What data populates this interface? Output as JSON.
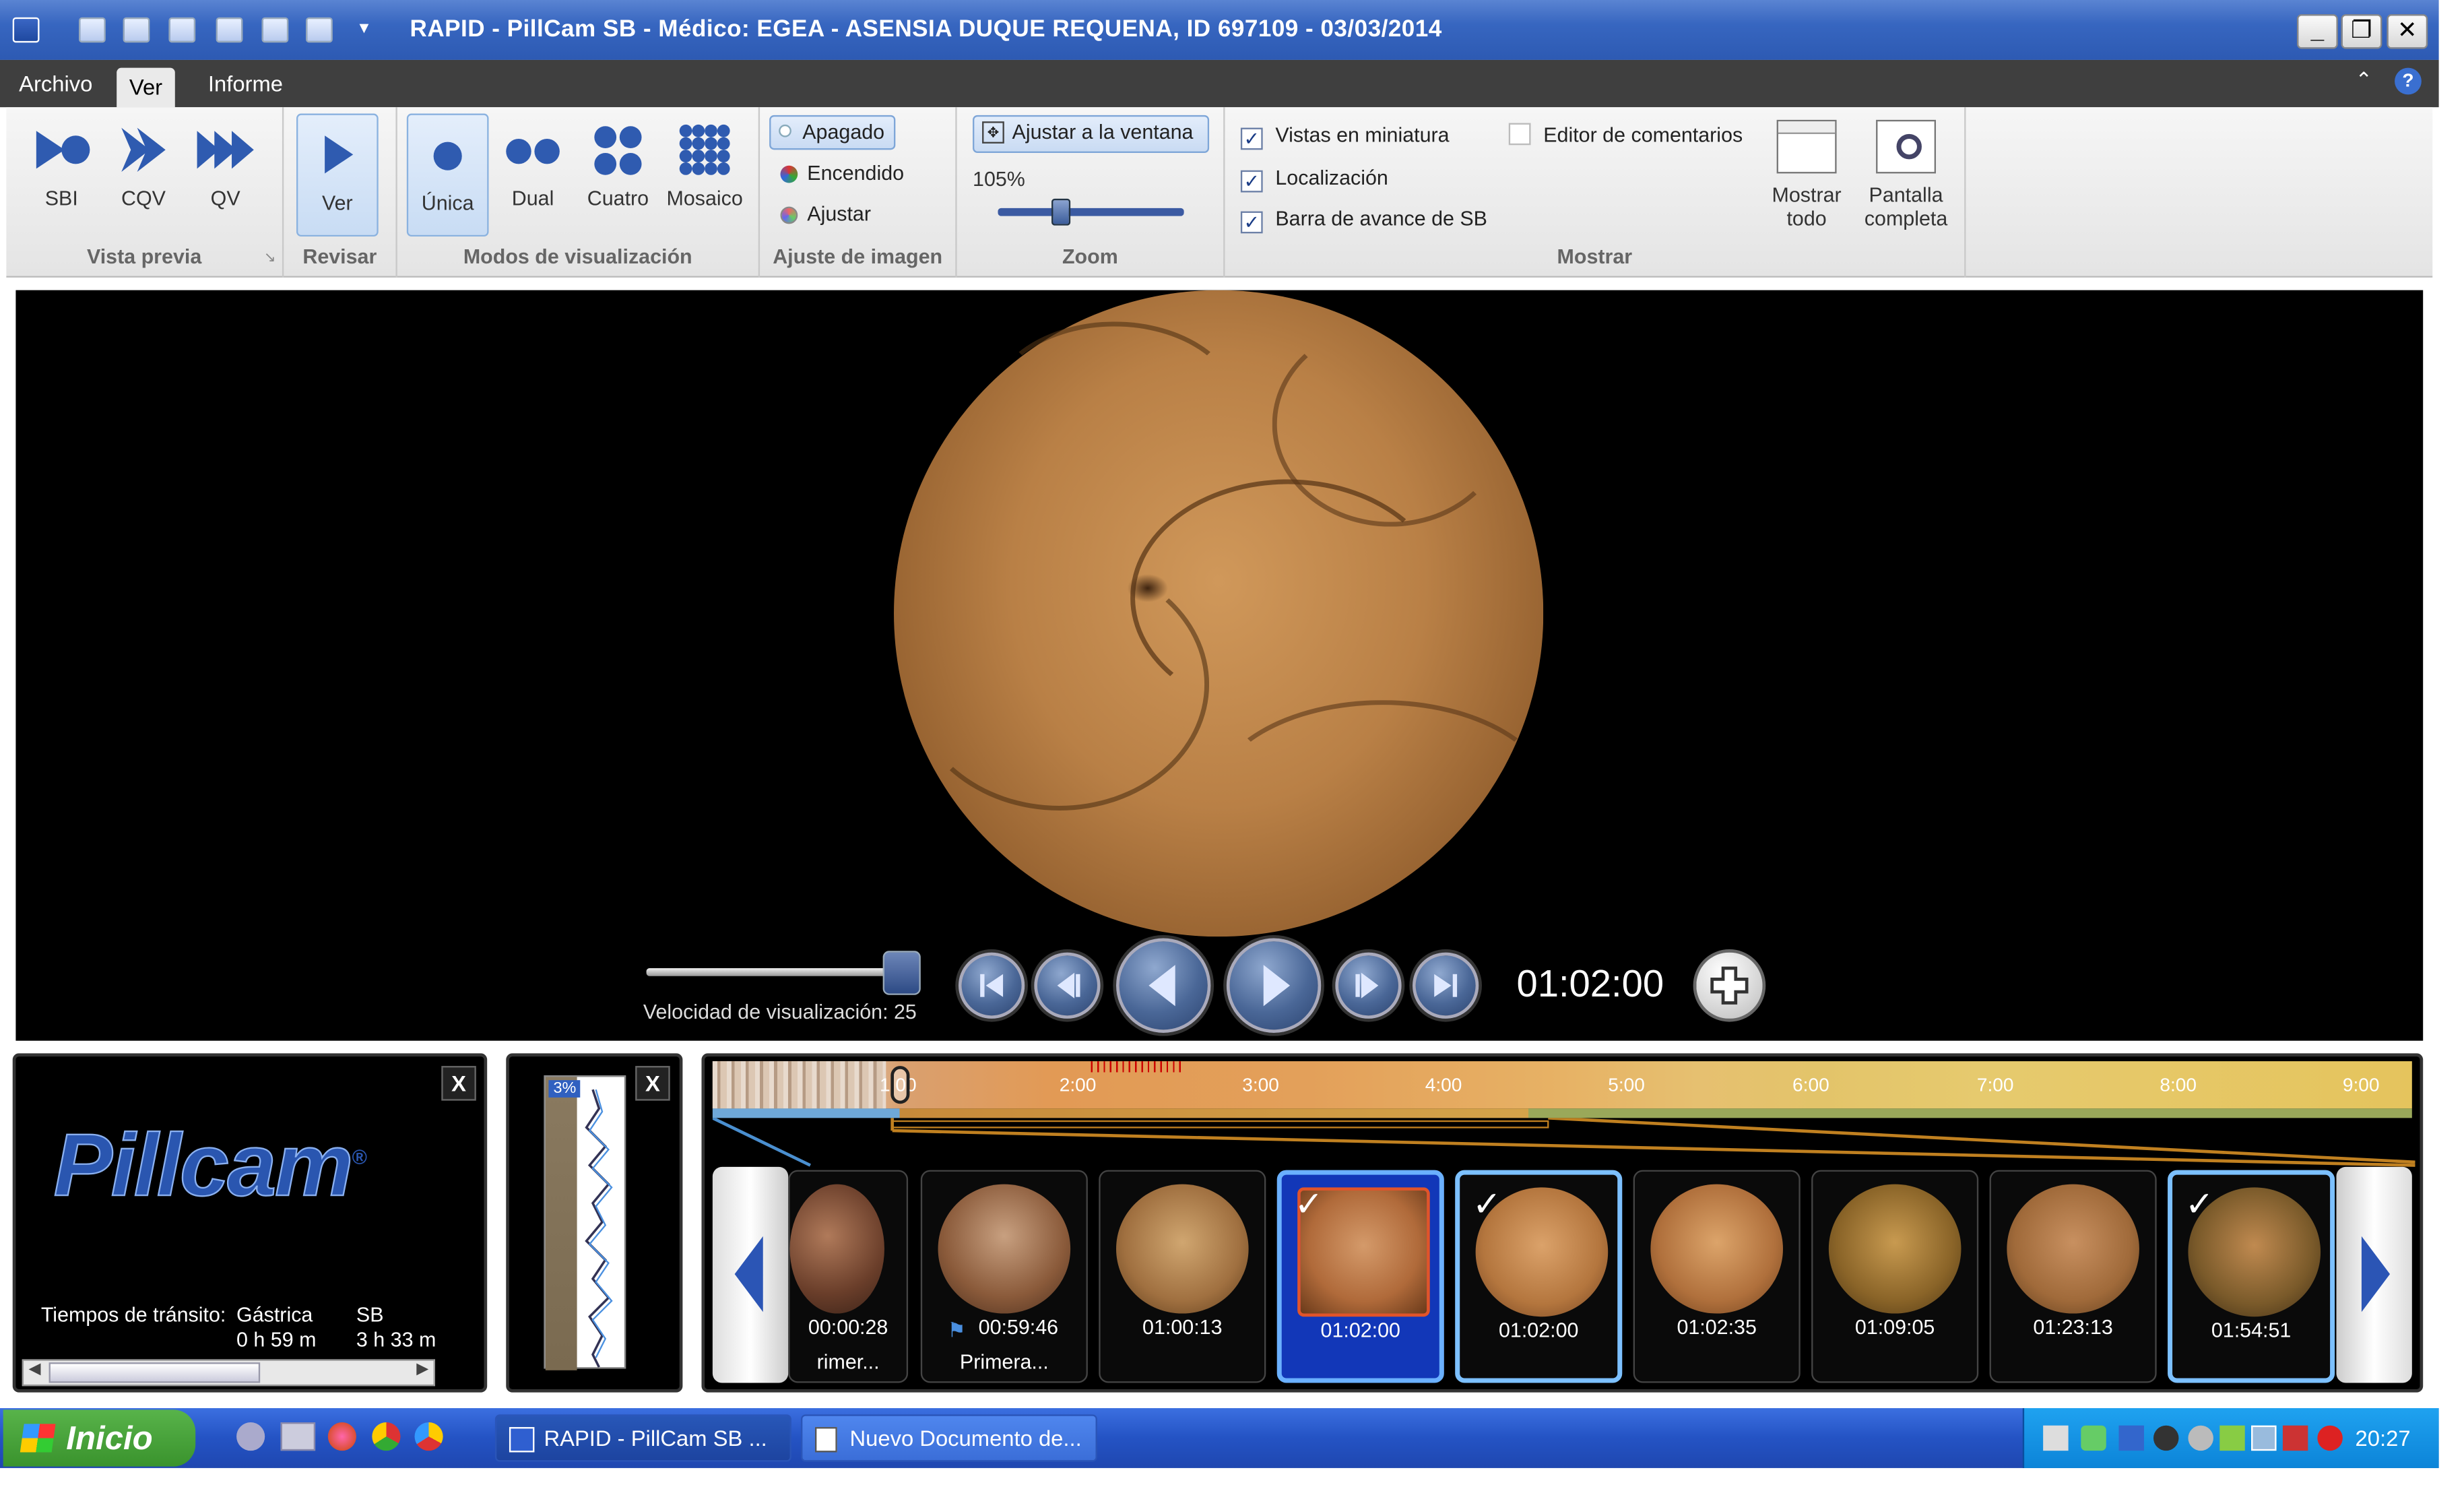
{
  "window": {
    "title": "RAPID   -   PillCam SB   -   Médico: EGEA   -   ASENSIA DUQUE REQUENA, ID 697109   -   03/03/2014",
    "controls": {
      "minimize": "_",
      "restore": "❐",
      "close": "✕"
    }
  },
  "menu": {
    "items": [
      "Archivo",
      "Ver",
      "Informe"
    ],
    "active": "Ver"
  },
  "ribbon": {
    "vista_previa": {
      "label": "Vista previa",
      "buttons": [
        "SBI",
        "CQV",
        "QV"
      ]
    },
    "revisar": {
      "label": "Revisar",
      "button": "Ver"
    },
    "modos": {
      "label": "Modos de visualización",
      "buttons": [
        "Única",
        "Dual",
        "Cuatro",
        "Mosaico"
      ],
      "selected": "Única"
    },
    "ajuste": {
      "label": "Ajuste de imagen",
      "options": [
        "Apagado",
        "Encendido",
        "Ajustar"
      ],
      "selected": "Apagado"
    },
    "zoom": {
      "label": "Zoom",
      "fit_button": "Ajustar a la ventana",
      "value": "105%",
      "slider_position": 0.3
    },
    "mostrar": {
      "label": "Mostrar",
      "checkboxes": [
        {
          "label": "Vistas en miniatura",
          "checked": true
        },
        {
          "label": "Localización",
          "checked": true
        },
        {
          "label": "Barra de avance de SB",
          "checked": true
        },
        {
          "label": "Editor de comentarios",
          "checked": false
        }
      ],
      "show_all": "Mostrar todo",
      "fullscreen": "Pantalla completa"
    }
  },
  "player": {
    "speed_label": "Velocidad de visualización: 25",
    "speed_position": 1.0,
    "time": "01:02:00",
    "add_icon": "plus-icon"
  },
  "logo_panel": {
    "logo": "Pillcam",
    "transit_label": "Tiempos de tránsito:",
    "gastric_header": "Gástrica",
    "gastric_value": "0 h 59 m",
    "sb_header": "SB",
    "sb_value": "3 h 33 m",
    "close": "X"
  },
  "graph_panel": {
    "percent": "3%",
    "close": "X"
  },
  "timeline": {
    "ticks": [
      "1:00",
      "2:00",
      "3:00",
      "4:00",
      "5:00",
      "6:00",
      "7:00",
      "8:00",
      "9:00"
    ]
  },
  "thumbnails": [
    {
      "time": "00:00:28",
      "caption": "rimer...",
      "state": "normal",
      "flag": false,
      "checked": false
    },
    {
      "time": "00:59:46",
      "caption": "Primera...",
      "state": "normal",
      "flag": true,
      "checked": false
    },
    {
      "time": "01:00:13",
      "caption": "",
      "state": "normal",
      "flag": false,
      "checked": false
    },
    {
      "time": "01:02:00",
      "caption": "",
      "state": "selected",
      "flag": false,
      "checked": true
    },
    {
      "time": "01:02:00",
      "caption": "",
      "state": "highlight",
      "flag": false,
      "checked": true
    },
    {
      "time": "01:02:35",
      "caption": "",
      "state": "normal",
      "flag": false,
      "checked": false
    },
    {
      "time": "01:09:05",
      "caption": "",
      "state": "normal",
      "flag": false,
      "checked": false
    },
    {
      "time": "01:23:13",
      "caption": "",
      "state": "normal",
      "flag": false,
      "checked": false
    },
    {
      "time": "01:54:51",
      "caption": "",
      "state": "highlight",
      "flag": false,
      "checked": true
    }
  ],
  "taskbar": {
    "start": "Inicio",
    "tasks": [
      "RAPID   -   PillCam SB ...",
      "Nuevo Documento de..."
    ],
    "clock": "20:27"
  }
}
